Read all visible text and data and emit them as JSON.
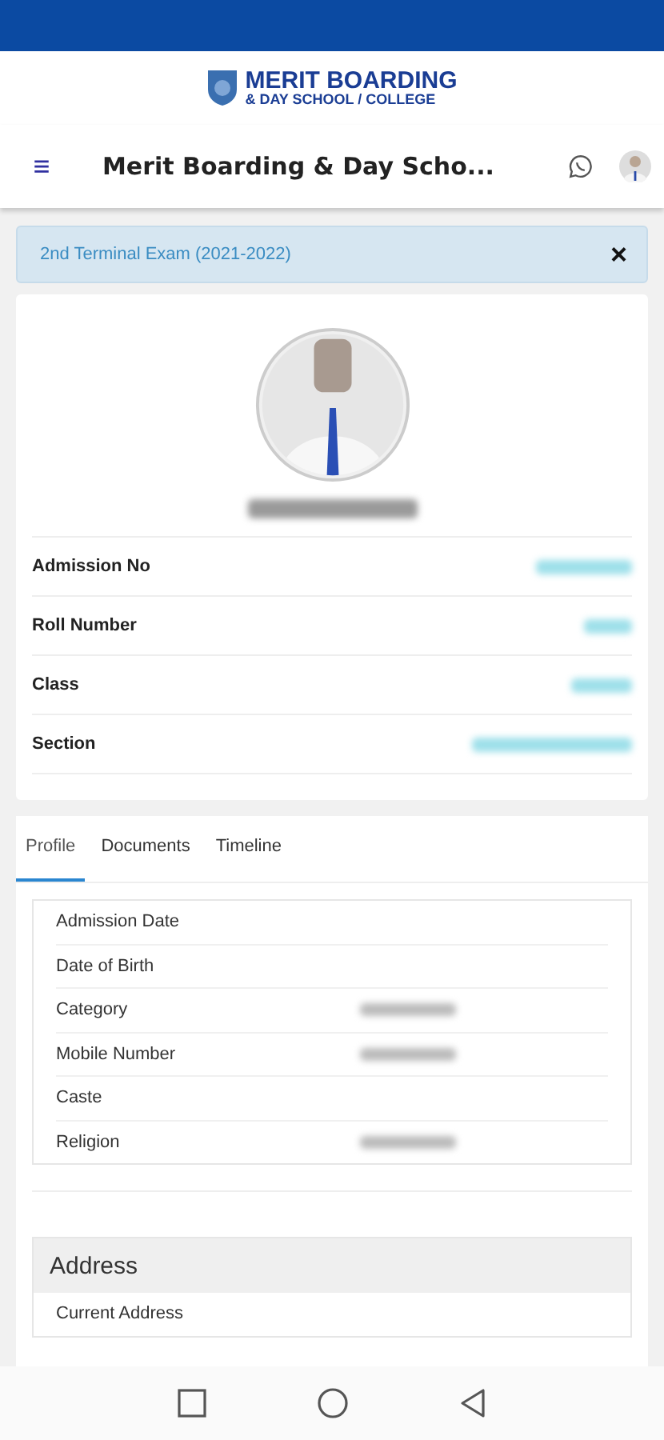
{
  "logo": {
    "line1": "MERIT BOARDING",
    "line2": "& DAY SCHOOL / COLLEGE"
  },
  "app_bar": {
    "menu_icon": "≡",
    "title": "Merit Boarding & Day Scho..."
  },
  "alert": {
    "text": "2nd Terminal Exam (2021-2022)",
    "close": "×"
  },
  "student": {
    "name_blurred": true,
    "fields": [
      {
        "label": "Admission No",
        "value_blurred": true
      },
      {
        "label": "Roll Number",
        "value_blurred": true
      },
      {
        "label": "Class",
        "value_blurred": true
      },
      {
        "label": "Section",
        "value_blurred": true
      }
    ]
  },
  "tabs": [
    {
      "label": "Profile",
      "selected": true
    },
    {
      "label": "Documents",
      "selected": false
    },
    {
      "label": "Timeline",
      "selected": false
    }
  ],
  "profile_rows": [
    {
      "label": "Admission Date",
      "value_blurred": false
    },
    {
      "label": "Date of Birth",
      "value_blurred": false
    },
    {
      "label": "Category",
      "value_blurred": true
    },
    {
      "label": "Mobile Number",
      "value_blurred": true
    },
    {
      "label": "Caste",
      "value_blurred": false
    },
    {
      "label": "Religion",
      "value_blurred": true
    }
  ],
  "address": {
    "title": "Address",
    "rows": [
      {
        "label": "Current Address"
      }
    ]
  }
}
